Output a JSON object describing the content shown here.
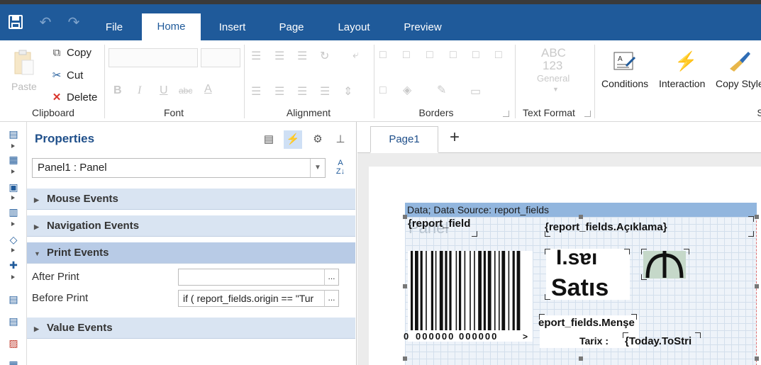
{
  "tabs": [
    "File",
    "Home",
    "Insert",
    "Page",
    "Layout",
    "Preview"
  ],
  "active_tab": "Home",
  "ribbon": {
    "clipboard": {
      "label": "Clipboard",
      "paste": "Paste",
      "copy": "Copy",
      "cut": "Cut",
      "delete": "Delete"
    },
    "font": {
      "label": "Font",
      "bold": "B",
      "italic": "I",
      "underline": "U",
      "strike": "abc",
      "color": "A"
    },
    "alignment": {
      "label": "Alignment"
    },
    "borders": {
      "label": "Borders"
    },
    "text_format": {
      "label": "Text Format",
      "sample_top": "ABC",
      "sample_mid": "123",
      "general": "General"
    },
    "conditions": "Conditions",
    "interaction": "Interaction",
    "copy_style": "Copy Style",
    "cut_letter": "S"
  },
  "properties": {
    "title": "Properties",
    "selected_object": "Panel1 : Panel",
    "categories": {
      "mouse": "Mouse Events",
      "navigation": "Navigation Events",
      "print": "Print Events",
      "value": "Value Events"
    },
    "after_print": {
      "label": "After Print",
      "value": ""
    },
    "before_print": {
      "label": "Before Print",
      "value": "if ( report_fields.origin == \"Tur"
    },
    "ellipsis": "..."
  },
  "design": {
    "page_tab": "Page1",
    "add_tab": "+",
    "band_header": "Data; Data Source: report_fields",
    "panel_ghost": "Panel",
    "field_left": "{report_field",
    "field_aciklama": "{report_fields.Açıklama}",
    "title_mirrored": "Ɩ.sɐı",
    "title_satis": "Satıs",
    "field_mense": "eport_fields.Menşe",
    "tarix": "Tarix :",
    "today": "{Today.ToStri",
    "barcode_digits": "000000 000000",
    "barcode_left_mark": "0",
    "barcode_right_mark": ">"
  },
  "colors": {
    "accent": "#1f5a9a",
    "band_header": "#92b6de",
    "category_bg": "#d9e4f2"
  }
}
